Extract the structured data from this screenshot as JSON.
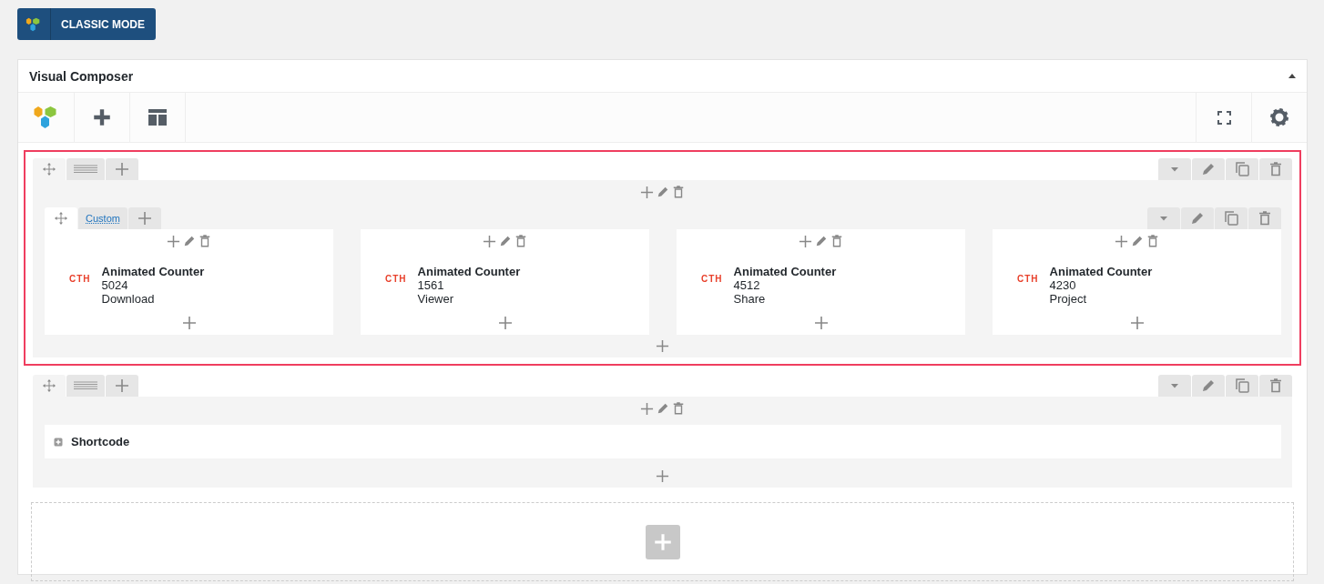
{
  "mode_button": {
    "label": "CLASSIC MODE"
  },
  "panel": {
    "title": "Visual Composer"
  },
  "rows": [
    {
      "selected": true,
      "content": [
        {
          "kind": "inner_row",
          "tab_label": "Custom",
          "columns": [
            {
              "elements": [
                {
                  "kind": "counter",
                  "logo": "CTH",
                  "title": "Animated Counter",
                  "number": "5024",
                  "label": "Download"
                }
              ]
            },
            {
              "elements": [
                {
                  "kind": "counter",
                  "logo": "CTH",
                  "title": "Animated Counter",
                  "number": "1561",
                  "label": "Viewer"
                }
              ]
            },
            {
              "elements": [
                {
                  "kind": "counter",
                  "logo": "CTH",
                  "title": "Animated Counter",
                  "number": "4512",
                  "label": "Share"
                }
              ]
            },
            {
              "elements": [
                {
                  "kind": "counter",
                  "logo": "CTH",
                  "title": "Animated Counter",
                  "number": "4230",
                  "label": "Project"
                }
              ]
            }
          ]
        }
      ]
    },
    {
      "selected": false,
      "content": [
        {
          "kind": "shortcode",
          "title": "Shortcode"
        }
      ]
    }
  ]
}
